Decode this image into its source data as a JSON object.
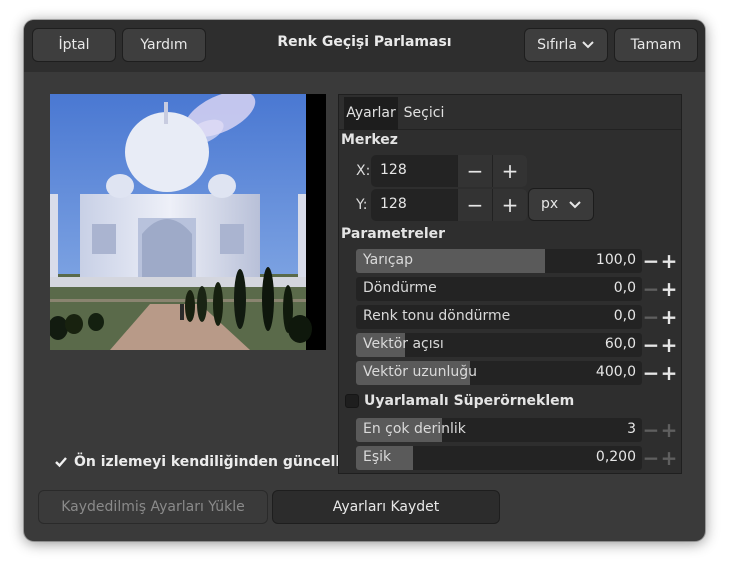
{
  "header": {
    "cancel_label": "İptal",
    "help_label": "Yardım",
    "title": "Renk Geçişi Parlaması",
    "reset_label": "Sıfırla",
    "ok_label": "Tamam"
  },
  "tabs": [
    "Ayarlar",
    "Seçici"
  ],
  "center": {
    "heading": "Merkez",
    "x_label": "X:",
    "x_value": "128",
    "y_label": "Y:",
    "y_value": "128",
    "unit": "px"
  },
  "params": {
    "heading": "Parametreler",
    "rows": [
      {
        "label": "Yarıçap",
        "value": "100,0",
        "fill": 0.66
      },
      {
        "label": "Döndürme",
        "value": "0,0",
        "fill": 0.0
      },
      {
        "label": "Renk tonu döndürme",
        "value": "0,0",
        "fill": 0.0
      },
      {
        "label": "Vektör açısı",
        "value": "60,0",
        "fill": 0.17
      },
      {
        "label": "Vektör uzunluğu",
        "value": "400,0",
        "fill": 0.4
      }
    ]
  },
  "supersample": {
    "label": "Uyarlamalı Süperörneklem",
    "checked": false,
    "rows": [
      {
        "label": "En çok derinlik",
        "value": "3",
        "fill": 0.3
      },
      {
        "label": "Eşik",
        "value": "0,200",
        "fill": 0.2
      }
    ]
  },
  "preview": {
    "auto_update_label": "Ön izlemeyi kendiliğinden güncelle",
    "auto_update_checked": true
  },
  "footer": {
    "load_label": "Kaydedilmiş Ayarları Yükle",
    "save_label": "Ayarları Kaydet"
  },
  "colors": {
    "window_bg": "#3a3a3a",
    "header_bg": "#2e2e2e",
    "panel_bg": "#2e2e2e",
    "scale_fill": "#5a5a5a"
  },
  "icons": [
    "chevron-down-icon",
    "minus-icon",
    "plus-icon",
    "checkmark-icon"
  ]
}
